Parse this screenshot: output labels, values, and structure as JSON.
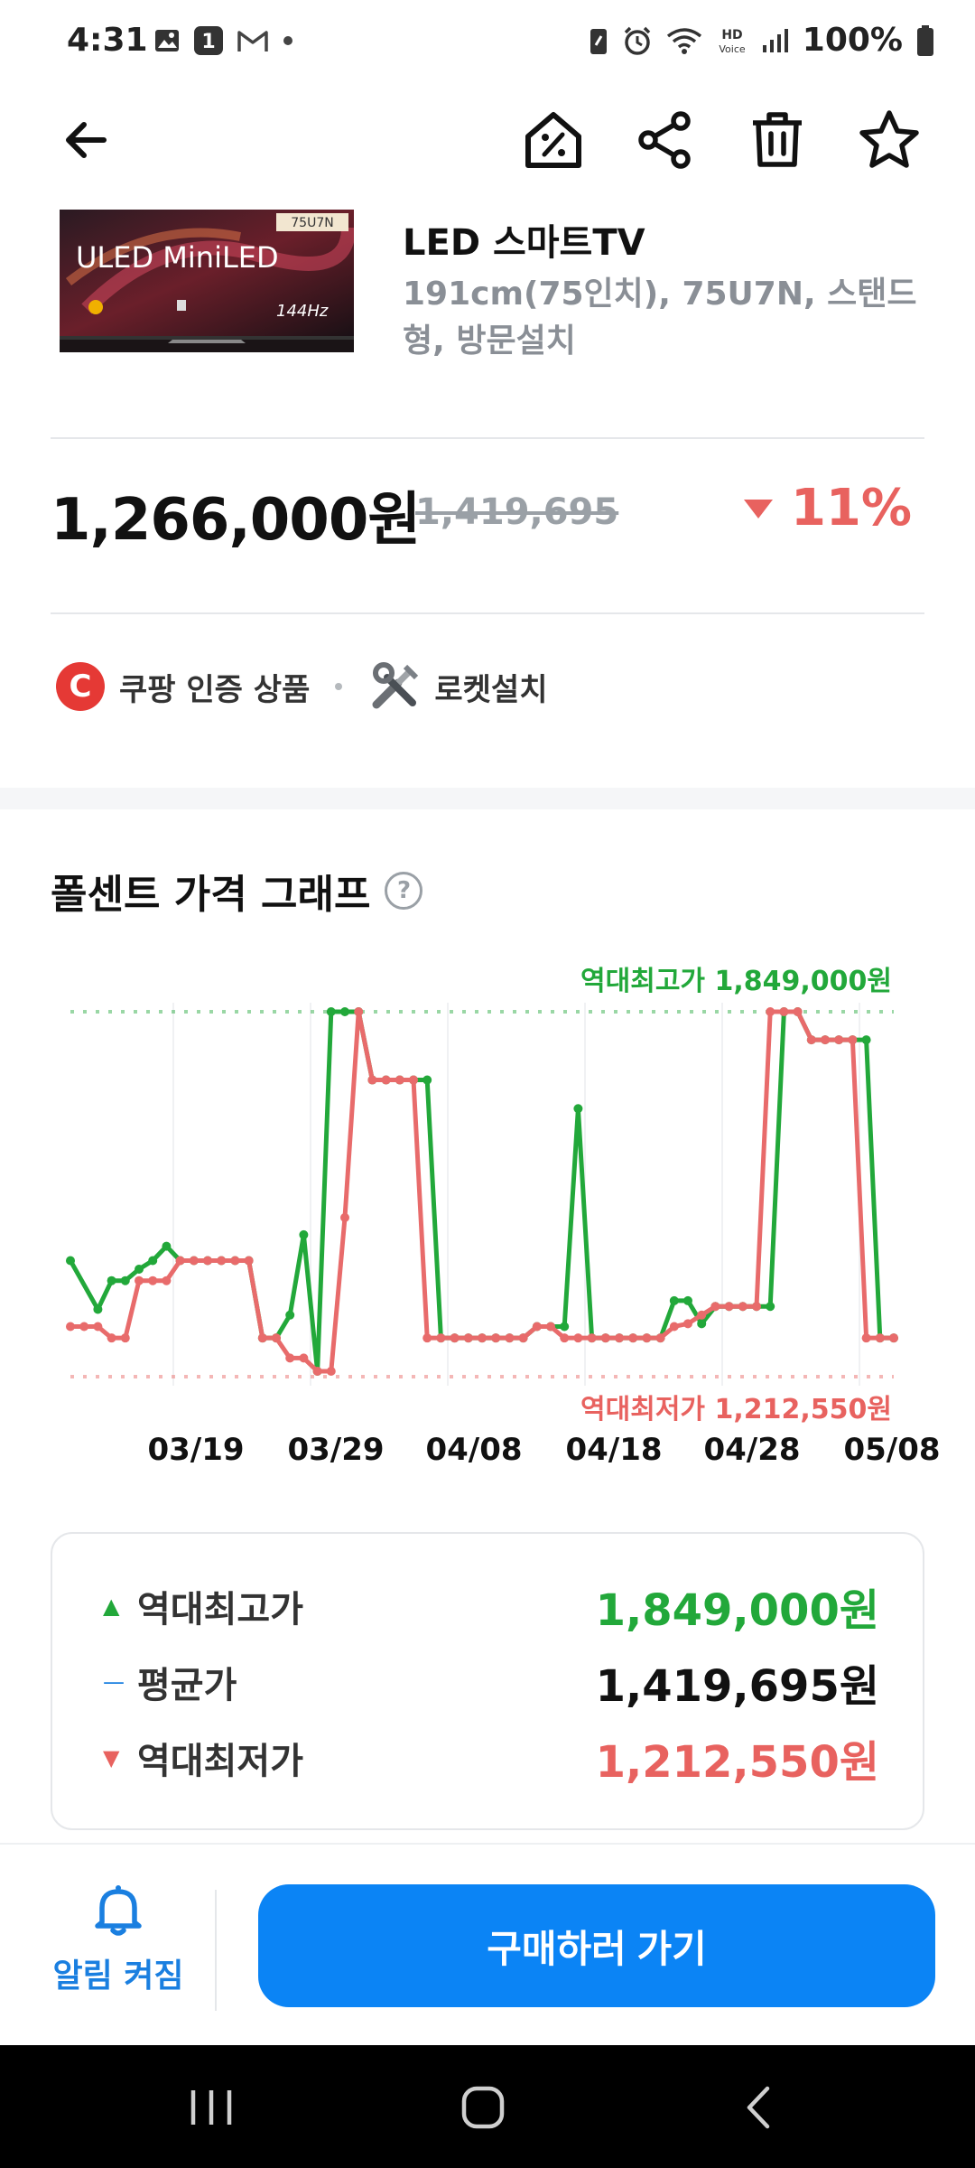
{
  "status_bar": {
    "time": "4:31",
    "battery": "100%"
  },
  "product": {
    "title": "LED 스마트TV",
    "subtitle": "191cm(75인치), 75U7N, 스탠드형, 방문설치",
    "image_text": {
      "model": "75U7N",
      "brand": "ULED MiniLED",
      "hz": "144Hz"
    }
  },
  "price": {
    "current": "1,266,000원",
    "original": "1,419,695",
    "discount": "11%"
  },
  "badges": {
    "certified": "쿠팡 인증 상품",
    "rocket_install": "로켓설치",
    "c_letter": "C"
  },
  "chart": {
    "title": "폴센트 가격 그래프",
    "help": "?"
  },
  "chart_data": {
    "type": "line",
    "x_tick_labels": [
      "03/19",
      "03/29",
      "04/08",
      "04/18",
      "04/28",
      "05/08"
    ],
    "ylim": [
      1212550,
      1849000
    ],
    "annotations": {
      "max_label": "역대최고가 1,849,000원",
      "min_label": "역대최저가 1,212,550원"
    },
    "series": [
      {
        "color": "#22a83a",
        "x": [
          0,
          2,
          3,
          4,
          5,
          6,
          7,
          8,
          9,
          10,
          11,
          12,
          13,
          14,
          15,
          16,
          17,
          18,
          19,
          20,
          21,
          22,
          23,
          24,
          25,
          26,
          27,
          28,
          29,
          30,
          31,
          32,
          33,
          34,
          35,
          36,
          37,
          38,
          39,
          40,
          41,
          42,
          43,
          44,
          45,
          46,
          47,
          48,
          49,
          50,
          51,
          52,
          53,
          54,
          55,
          56,
          57,
          58,
          59,
          60
        ],
        "values": [
          1415000,
          1330000,
          1380000,
          1380000,
          1400000,
          1415000,
          1440000,
          1415000,
          1415000,
          1415000,
          1415000,
          1415000,
          1415000,
          1280000,
          1280000,
          1320000,
          1460000,
          1222000,
          1849000,
          1849000,
          1849000,
          1730000,
          1730000,
          1730000,
          1730000,
          1730000,
          1280000,
          1280000,
          1280000,
          1280000,
          1280000,
          1280000,
          1280000,
          1300000,
          1300000,
          1300000,
          1680000,
          1280000,
          1280000,
          1280000,
          1280000,
          1280000,
          1280000,
          1345000,
          1345000,
          1305000,
          1335000,
          1335000,
          1335000,
          1335000,
          1335000,
          1849000,
          1849000,
          1800000,
          1800000,
          1800000,
          1800000,
          1800000,
          1280000,
          1280000
        ],
        "marker_x": [
          56
        ],
        "marker_values": [
          1800000
        ]
      },
      {
        "color": "#e86b6b",
        "x": [
          0,
          1,
          2,
          3,
          4,
          5,
          6,
          7,
          8,
          9,
          10,
          11,
          12,
          13,
          14,
          15,
          16,
          17,
          18,
          19,
          20,
          21,
          22,
          23,
          24,
          25,
          26,
          27,
          28,
          29,
          30,
          31,
          32,
          33,
          34,
          35,
          36,
          37,
          38,
          39,
          40,
          41,
          42,
          43,
          44,
          45,
          46,
          47,
          48,
          49,
          50,
          51,
          52,
          53,
          54,
          55,
          56,
          57,
          58,
          59,
          60
        ],
        "values": [
          1300000,
          1300000,
          1300000,
          1280000,
          1280000,
          1380000,
          1380000,
          1380000,
          1415000,
          1415000,
          1415000,
          1415000,
          1415000,
          1415000,
          1280000,
          1280000,
          1245000,
          1245000,
          1222000,
          1222000,
          1490000,
          1849000,
          1730000,
          1730000,
          1730000,
          1730000,
          1280000,
          1280000,
          1280000,
          1280000,
          1280000,
          1280000,
          1280000,
          1280000,
          1300000,
          1300000,
          1280000,
          1280000,
          1280000,
          1280000,
          1280000,
          1280000,
          1280000,
          1280000,
          1300000,
          1305000,
          1320000,
          1335000,
          1335000,
          1335000,
          1335000,
          1849000,
          1849000,
          1849000,
          1800000,
          1800000,
          1800000,
          1800000,
          1280000,
          1280000,
          1280000
        ]
      }
    ]
  },
  "stats": {
    "max": {
      "label": "역대최고가",
      "value": "1,849,000원",
      "mark": "▲"
    },
    "avg": {
      "label": "평균가",
      "value": "1,419,695원",
      "mark": "—"
    },
    "min": {
      "label": "역대최저가",
      "value": "1,212,550원",
      "mark": "▼"
    }
  },
  "bottom": {
    "alarm_label": "알림 켜짐",
    "buy_label": "구매하러 가기"
  },
  "colors": {
    "accent": "#0b84f5",
    "up": "#22a83a",
    "down": "#e8625f"
  }
}
